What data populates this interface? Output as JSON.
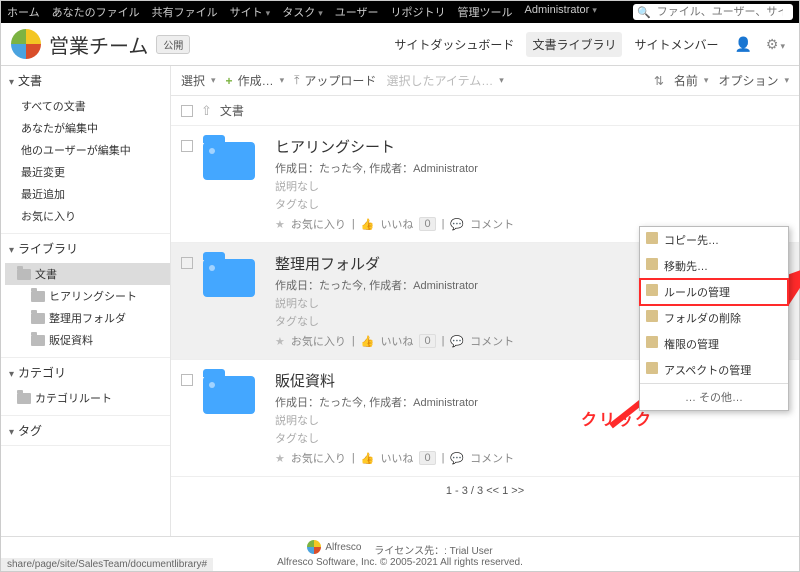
{
  "topmenu": [
    "ホーム",
    "あなたのファイル",
    "共有ファイル",
    "サイト",
    "タスク",
    "ユーザー",
    "リポジトリ",
    "管理ツール",
    "Administrator"
  ],
  "topmenu_caret": [
    false,
    false,
    false,
    true,
    true,
    false,
    false,
    false,
    true
  ],
  "search_placeholder": "ファイル、ユーザー、サイトの",
  "site": {
    "name": "営業チーム",
    "badge": "公開"
  },
  "sitenav": {
    "dashboard": "サイトダッシュボード",
    "doclib": "文書ライブラリ",
    "members": "サイトメンバー"
  },
  "sidebar": {
    "docs": {
      "head": "文書",
      "items": [
        "すべての文書",
        "あなたが編集中",
        "他のユーザーが編集中",
        "最近変更",
        "最近追加",
        "お気に入り"
      ]
    },
    "library": {
      "head": "ライブラリ",
      "items": [
        "文書",
        "ヒアリングシート",
        "整理用フォルダ",
        "販促資料"
      ]
    },
    "category": {
      "head": "カテゴリ",
      "items": [
        "カテゴリルート"
      ]
    },
    "tag": {
      "head": "タグ"
    }
  },
  "toolbar": {
    "select": "選択",
    "create": "作成…",
    "upload": "アップロード",
    "selected": "選択したアイテム…",
    "sort": "名前",
    "options": "オプション"
  },
  "crumbs": {
    "root": "文書"
  },
  "items": [
    {
      "title": "ヒアリングシート",
      "created": "作成日：たった今, 作成者：Administrator",
      "desc": "説明なし",
      "tags": "タグなし",
      "fav": "お気に入り",
      "like": "いいね",
      "likec": "0",
      "comment": "コメント"
    },
    {
      "title": "整理用フォルダ",
      "created": "作成日：たった今, 作成者：Administrator",
      "desc": "説明なし",
      "tags": "タグなし",
      "fav": "お気に入り",
      "like": "いいね",
      "likec": "0",
      "comment": "コメント"
    },
    {
      "title": "販促資料",
      "created": "作成日：たった今, 作成者：Administrator",
      "desc": "説明なし",
      "tags": "タグなし",
      "fav": "お気に入り",
      "like": "いいね",
      "likec": "0",
      "comment": "コメント"
    }
  ],
  "pager": "1 - 3 / 3   <<    1    >>",
  "ctx": [
    "コピー先…",
    "移動先…",
    "ルールの管理",
    "フォルダの削除",
    "権限の管理",
    "アスペクトの管理",
    "… その他…"
  ],
  "annotation": {
    "click": "クリック"
  },
  "footer": {
    "brand": "Alfresco",
    "license": "ライセンス先：: Trial User",
    "copyright": "Alfresco Software, Inc. © 2005-2021 All rights reserved."
  },
  "url": "share/page/site/SalesTeam/documentlibrary#"
}
